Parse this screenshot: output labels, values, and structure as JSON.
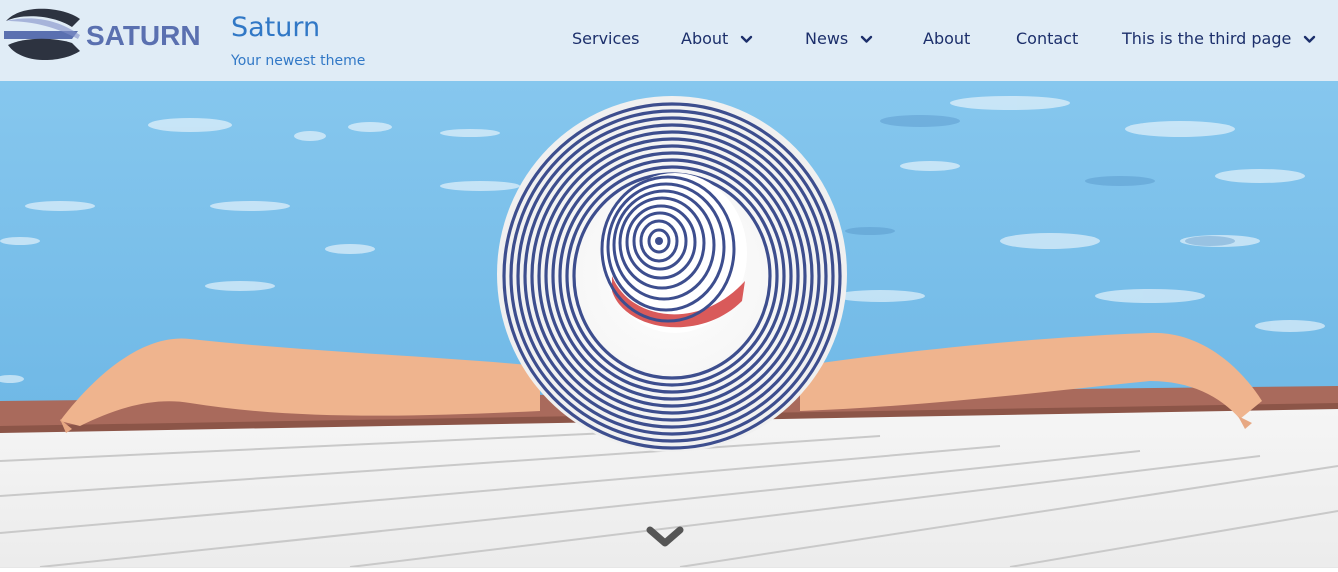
{
  "brand": {
    "logo_text": "SATURN",
    "site_title": "Saturn",
    "tagline": "Your newest theme",
    "logo_icon": "saturn-logo-icon"
  },
  "nav": {
    "items": [
      {
        "label": "Services",
        "has_dropdown": false
      },
      {
        "label": "About",
        "has_dropdown": true
      },
      {
        "label": "News",
        "has_dropdown": true
      },
      {
        "label": "About",
        "has_dropdown": false
      },
      {
        "label": "Contact",
        "has_dropdown": false
      },
      {
        "label": "This is the third page",
        "has_dropdown": true
      }
    ],
    "dropdown_icon": "chevron-down-icon"
  },
  "hero": {
    "scroll_icon": "chevron-down-icon"
  },
  "colors": {
    "header_bg": "#e0ecf6",
    "title_blue": "#3178c6",
    "nav_text": "#1c2f6b",
    "water": "#7cc2ec",
    "hat_stripe": "#3d4e8e"
  }
}
